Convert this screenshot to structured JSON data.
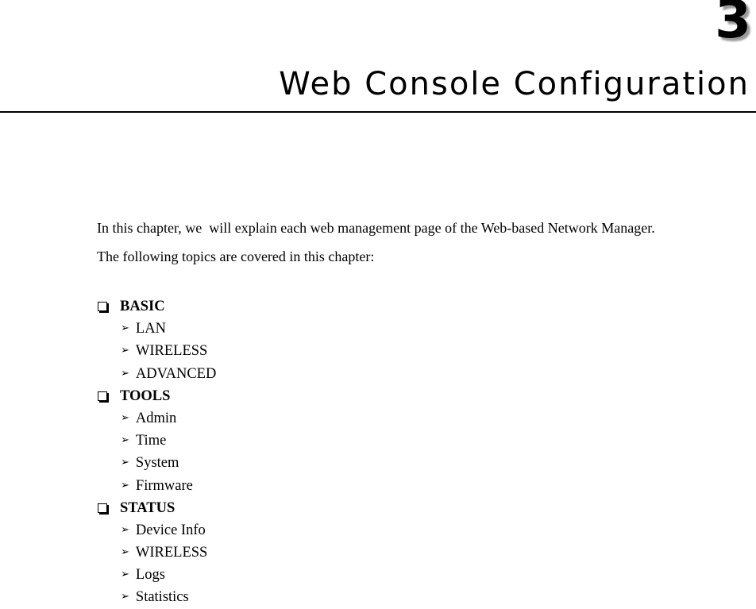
{
  "header": {
    "chapter_number": "3",
    "chapter_title": "Web Console Configuration"
  },
  "intro": {
    "line1": "In this chapter, we  will explain each web management page of the Web-based Network Manager.",
    "line2": "The following topics are covered in this chapter:"
  },
  "icons": {
    "section_bullet": "checkbox-square-icon",
    "item_bullet": "arrowhead-icon",
    "arrow_glyph": "➢"
  },
  "sections": [
    {
      "label": "BASIC",
      "items": [
        "LAN",
        "WIRELESS",
        "ADVANCED"
      ]
    },
    {
      "label": "TOOLS",
      "items": [
        "Admin",
        "Time",
        "System",
        "Firmware"
      ]
    },
    {
      "label": "STATUS",
      "items": [
        "Device Info",
        "WIRELESS",
        "Logs",
        "Statistics"
      ]
    }
  ]
}
